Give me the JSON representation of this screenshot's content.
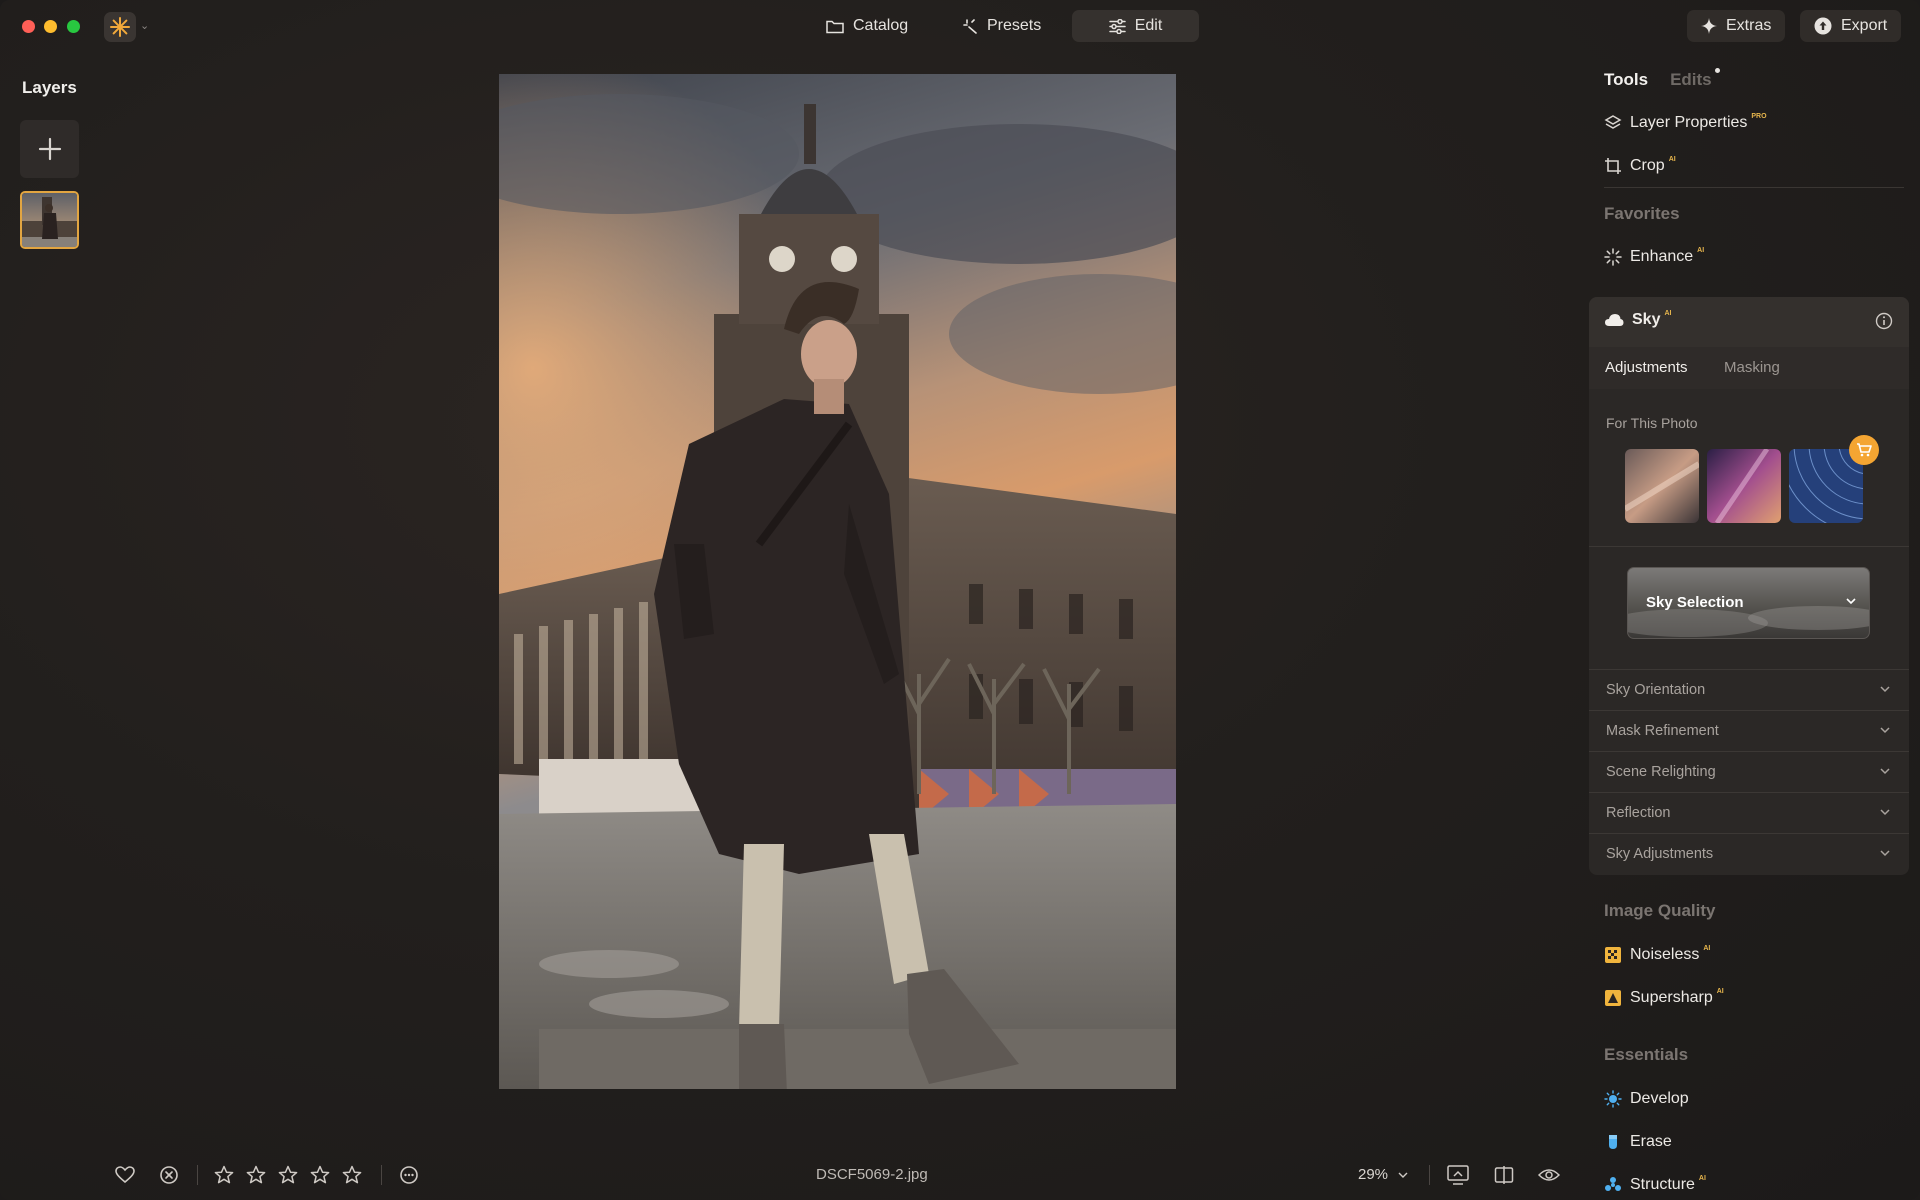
{
  "titlebar": {
    "nav": [
      {
        "label": "Catalog",
        "icon": "folder-icon"
      },
      {
        "label": "Presets",
        "icon": "sparkle-icon"
      },
      {
        "label": "Edit",
        "icon": "sliders-icon",
        "active": true
      }
    ],
    "extras_label": "Extras",
    "export_label": "Export"
  },
  "layers": {
    "title": "Layers"
  },
  "bottom": {
    "filename": "DSCF5069-2.jpg",
    "zoom": "29%",
    "rating_stars": 0
  },
  "panel": {
    "tab_tools": "Tools",
    "tab_edits": "Edits",
    "layer_properties": "Layer Properties",
    "layer_properties_badge": "PRO",
    "crop": "Crop",
    "crop_badge": "AI",
    "favorites": "Favorites",
    "enhance": "Enhance",
    "enhance_badge": "AI",
    "sky": {
      "title": "Sky",
      "badge": "AI",
      "tab_adjustments": "Adjustments",
      "tab_masking": "Masking",
      "for_this_photo": "For This Photo",
      "selection_label": "Sky Selection",
      "sections": [
        "Sky Orientation",
        "Mask Refinement",
        "Scene Relighting",
        "Reflection",
        "Sky Adjustments"
      ]
    },
    "image_quality": "Image Quality",
    "noiseless": "Noiseless",
    "noiseless_badge": "AI",
    "supersharp": "Supersharp",
    "supersharp_badge": "AI",
    "essentials": "Essentials",
    "develop": "Develop",
    "erase": "Erase",
    "structure": "Structure",
    "structure_badge": "AI"
  },
  "colors": {
    "accent": "#e2a541",
    "cart": "#f4a532"
  }
}
